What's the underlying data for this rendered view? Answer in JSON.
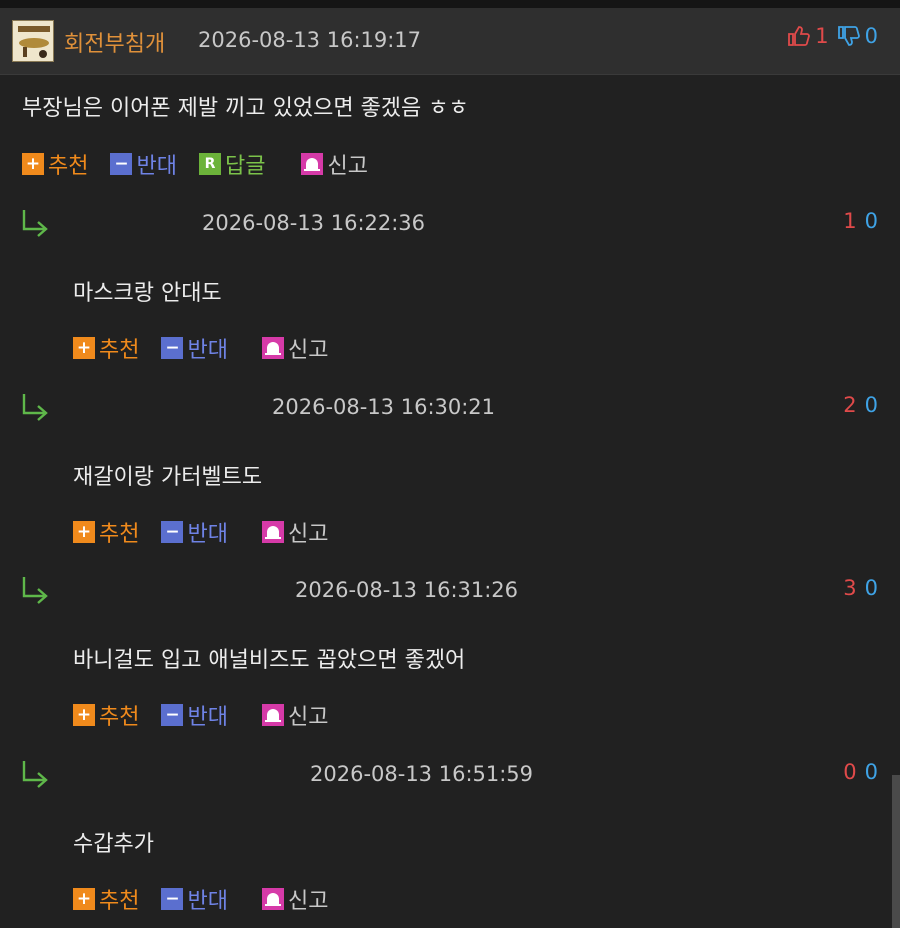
{
  "comment": {
    "nickname": "회전부침개",
    "date": "2026-08-13 16:19:17",
    "upvotes": "1",
    "downvotes": "0",
    "text": "부장님은 이어폰 제발 끼고 있었으면 좋겠음 ㅎㅎ",
    "actions": {
      "recommend": "추천",
      "oppose": "반대",
      "reply": "답글",
      "report": "신고"
    }
  },
  "replies": [
    {
      "date": "2026-08-13 16:22:36",
      "up": "1",
      "down": "0",
      "text": "마스크랑 안대도",
      "recommend": "추천",
      "oppose": "반대",
      "report": "신고"
    },
    {
      "date": "2026-08-13 16:30:21",
      "up": "2",
      "down": "0",
      "text": "재갈이랑 가터벨트도",
      "recommend": "추천",
      "oppose": "반대",
      "report": "신고"
    },
    {
      "date": "2026-08-13 16:31:26",
      "up": "3",
      "down": "0",
      "text": "바니걸도 입고 애널비즈도 꼽았으면 좋겠어",
      "recommend": "추천",
      "oppose": "반대",
      "report": "신고"
    },
    {
      "date": "2026-08-13 16:51:59",
      "up": "0",
      "down": "0",
      "text": "수갑추가",
      "recommend": "추천",
      "oppose": "반대",
      "report": "신고"
    }
  ],
  "icons": {
    "recommend": "plus-icon",
    "oppose": "minus-icon",
    "reply": "reply-icon",
    "report": "siren-icon",
    "reply_arrow": "reply-arrow-icon",
    "thumbs_up": "thumbs-up-icon",
    "thumbs_down": "thumbs-down-icon"
  },
  "colors": {
    "background": "#212121",
    "nickname": "#e0913a",
    "upvote": "#e04a4a",
    "downvote": "#3fa3e6",
    "recommend": "#f08a1c",
    "oppose": "#6f83e6",
    "reply": "#7cc34a",
    "report_icon": "#d63aa8"
  }
}
